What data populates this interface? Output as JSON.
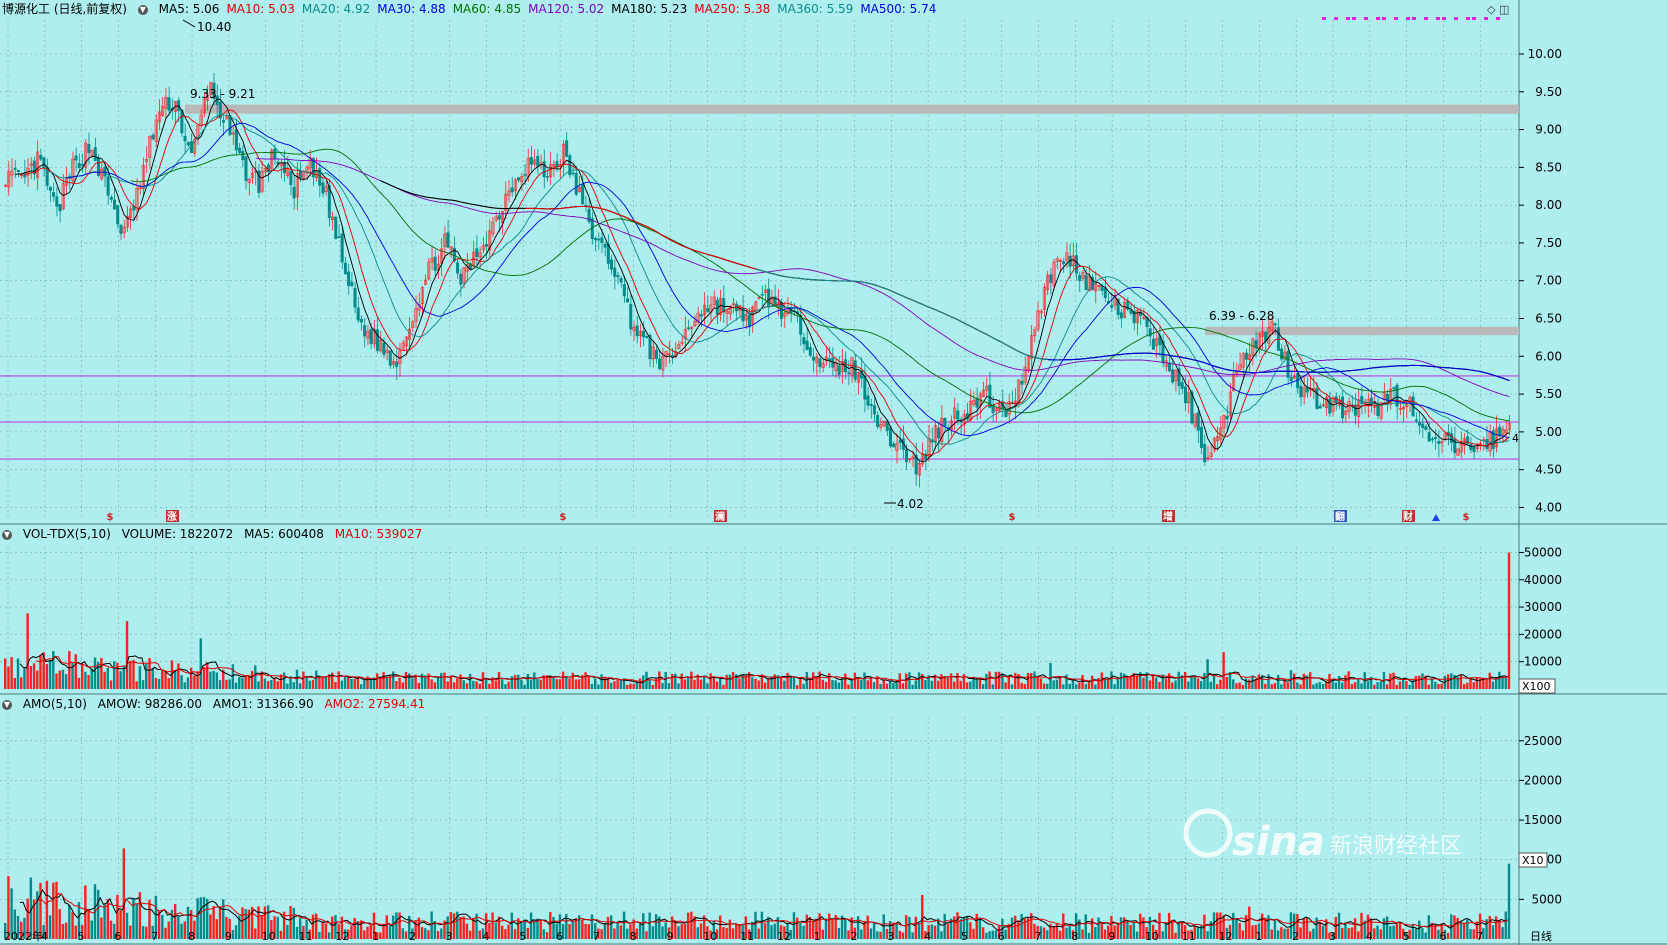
{
  "stock_name": "博源化工 (日线,前复权)",
  "main_ma": [
    {
      "label": "MA5: 5.06",
      "color": "#000000"
    },
    {
      "label": "MA10: 5.03",
      "color": "#e00000"
    },
    {
      "label": "MA20: 4.92",
      "color": "#0a8a8a"
    },
    {
      "label": "MA30: 4.88",
      "color": "#0000e0"
    },
    {
      "label": "MA60: 4.85",
      "color": "#007000"
    },
    {
      "label": "MA120: 5.02",
      "color": "#8000c0"
    },
    {
      "label": "MA180: 5.23",
      "color": "#000000"
    },
    {
      "label": "MA250: 5.38",
      "color": "#e00000"
    },
    {
      "label": "MA360: 5.59",
      "color": "#0a8a8a"
    },
    {
      "label": "MA500: 5.74",
      "color": "#0000e0"
    }
  ],
  "vol_header": {
    "name": "VOL-TDX(5,10)",
    "volume": "VOLUME: 1822072",
    "ma5": "MA5: 600408",
    "ma10": "MA10: 539027"
  },
  "amo_header": {
    "name": "AMO(5,10)",
    "amow": "AMOW: 98286.00",
    "amo1": "AMO1: 31366.90",
    "amo2": "AMO2: 27594.41"
  },
  "price_annotations": {
    "high": "10.40",
    "low": "4.02",
    "range1": "9.33 - 9.21",
    "range2": "6.39 - 6.28",
    "last_mark": "4"
  },
  "vol_unit": "X100",
  "amo_unit": "X10",
  "period_label": "日线",
  "year_label": "2022年",
  "watermark_logo": "sina",
  "watermark_text": "新浪财经社区",
  "event_markers": [
    "$",
    "涨",
    "$",
    "澜",
    "$",
    "增",
    "翻",
    "财",
    "$"
  ],
  "colors": {
    "up": "#ff2020",
    "down": "#008b8b",
    "bg": "#aeeeee",
    "grid": "#7aa8a8"
  },
  "chart_data": [
    {
      "type": "candlestick",
      "title": "博源化工 (日线,前复权)",
      "y_ticks": [
        "10.00",
        "9.50",
        "9.00",
        "8.50",
        "8.00",
        "7.50",
        "7.00",
        "6.50",
        "6.00",
        "5.50",
        "5.00",
        "4.50",
        "4.00"
      ],
      "ylim": [
        3.9,
        10.45
      ],
      "highest": 10.4,
      "lowest": 4.02,
      "support_lines": [
        5.74,
        5.13,
        4.64
      ],
      "resistance_bands": [
        {
          "from": 9.21,
          "to": 9.33
        },
        {
          "from": 6.28,
          "to": 6.39
        }
      ],
      "close_trend": [
        8.4,
        8.3,
        8.6,
        7.9,
        8.5,
        8.8,
        8.2,
        7.6,
        8.3,
        9.2,
        9.4,
        8.6,
        9.6,
        9.1,
        8.5,
        8.3,
        8.7,
        8.2,
        8.5,
        8.1,
        7.2,
        6.4,
        6.2,
        5.9,
        6.5,
        7.1,
        7.5,
        7.0,
        7.4,
        7.8,
        8.3,
        8.6,
        8.4,
        8.7,
        8.1,
        7.5,
        7.2,
        6.5,
        6.1,
        5.9,
        6.2,
        6.6,
        6.7,
        6.6,
        6.5,
        6.8,
        6.6,
        6.4,
        6.0,
        5.8,
        5.9,
        5.5,
        5.0,
        4.8,
        4.5,
        5.0,
        5.2,
        5.3,
        5.5,
        5.2,
        5.6,
        6.5,
        7.2,
        7.3,
        7.0,
        6.8,
        6.6,
        6.5,
        6.2,
        5.8,
        5.4,
        4.7,
        5.0,
        6.0,
        6.2,
        6.4,
        5.8,
        5.5,
        5.4,
        5.3,
        5.3,
        5.3,
        5.5,
        5.4,
        4.9,
        4.85,
        4.8,
        4.8,
        4.9,
        5.05
      ],
      "ma_last": {
        "MA5": 5.06,
        "MA10": 5.03,
        "MA20": 4.92,
        "MA30": 4.88,
        "MA60": 4.85,
        "MA120": 5.02,
        "MA180": 5.23,
        "MA250": 5.38,
        "MA360": 5.59,
        "MA500": 5.74
      }
    },
    {
      "type": "bar",
      "title": "VOL-TDX(5,10)",
      "y_ticks": [
        "50000",
        "40000",
        "30000",
        "20000",
        "10000"
      ],
      "ylim": [
        0,
        52000
      ],
      "unit": "X100",
      "last_volume": 1822072,
      "ma5": 600408,
      "ma10": 539027
    },
    {
      "type": "bar",
      "title": "AMO(5,10)",
      "y_ticks": [
        "25000",
        "20000",
        "15000",
        "10000",
        "5000"
      ],
      "ylim": [
        0,
        28000
      ],
      "unit": "X10",
      "amow": 98286.0,
      "amo1": 31366.9,
      "amo2": 27594.41
    }
  ],
  "x_months": [
    "2022年",
    "4",
    "5",
    "6",
    "7",
    "8",
    "9",
    "10",
    "11",
    "12",
    "1",
    "2",
    "3",
    "4",
    "5",
    "6",
    "7",
    "8",
    "9",
    "10",
    "11",
    "12",
    "1",
    "2",
    "3",
    "4",
    "5",
    "6",
    "7",
    "8",
    "9",
    "10",
    "11",
    "12",
    "1",
    "2",
    "3",
    "4",
    "5",
    "6",
    "7"
  ]
}
